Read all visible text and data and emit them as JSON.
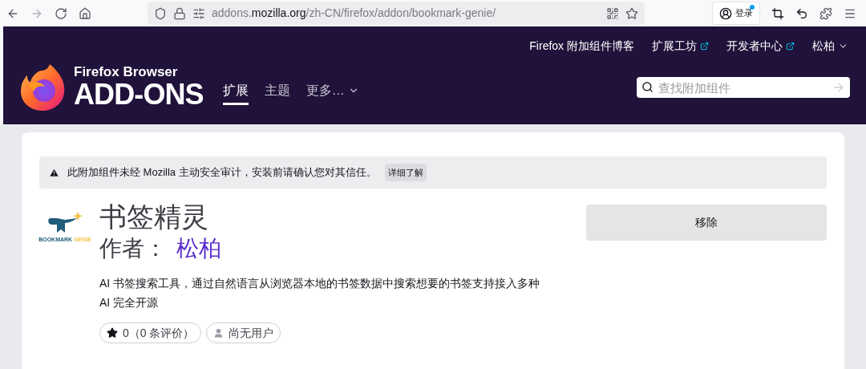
{
  "browser": {
    "url_host_prefix": "addons.",
    "url_domain": "mozilla.org",
    "url_path": "/zh-CN/firefox/addon/bookmark-genie/",
    "account_label": "登录"
  },
  "header": {
    "brand_top": "Firefox Browser",
    "brand_main": "ADD-ONS",
    "nav": [
      {
        "label": "扩展",
        "selected": true,
        "dropdown": false
      },
      {
        "label": "主题",
        "selected": false,
        "dropdown": false
      },
      {
        "label": "更多…",
        "selected": false,
        "dropdown": true
      }
    ],
    "top_links": [
      {
        "label": "Firefox 附加组件博客",
        "external": false,
        "dropdown": false
      },
      {
        "label": "扩展工坊",
        "external": true,
        "dropdown": false
      },
      {
        "label": "开发者中心",
        "external": true,
        "dropdown": false
      },
      {
        "label": "松柏",
        "external": false,
        "dropdown": true
      }
    ],
    "search": {
      "placeholder": "查找附加组件"
    }
  },
  "notice": {
    "text": "此附加组件未经 Mozilla 主动安全审计，安装前请确认您对其信任。",
    "button": "详细了解"
  },
  "addon": {
    "icon_caption": [
      "BOOKMARK",
      "GENIE"
    ],
    "name": "书签精灵",
    "author_label": "作者：",
    "author": "松柏",
    "description": [
      "AI 书签搜索工具，通过自然语言从浏览器本地的书签数据中搜索想要的书签支持接入多种",
      "AI 完全开源"
    ],
    "rating": "0（0 条评价）",
    "users": "尚无用户",
    "action_button": "移除"
  }
}
